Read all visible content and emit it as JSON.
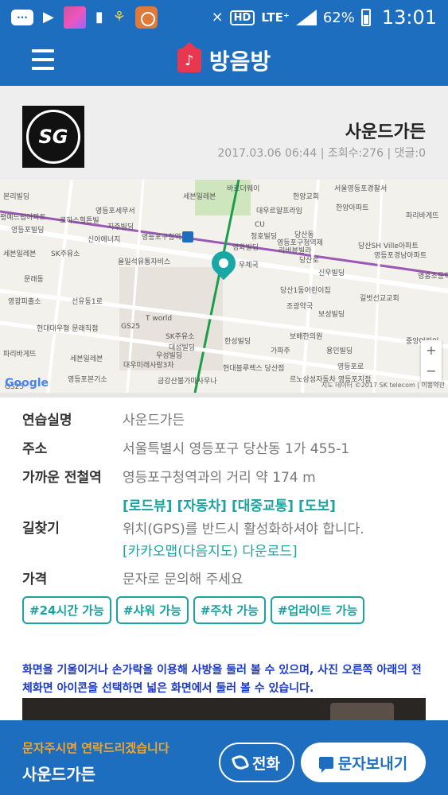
{
  "status_bar": {
    "network": "LTE⁺",
    "hd": "HD",
    "battery": "62%",
    "time": "13:01",
    "icons": [
      "chat-icon",
      "play-icon",
      "app-icon",
      "sim-icon",
      "ribbon-icon",
      "app-icon",
      "mute-vibrate-icon",
      "signal-icon",
      "battery-icon"
    ]
  },
  "app_bar": {
    "title": "방음방",
    "logo_icon": "music-note-icon",
    "menu_icon": "hamburger-icon"
  },
  "header": {
    "title": "사운드가든",
    "meta": "2017.03.06 06:44 | 조회수:276 | 댓글:0",
    "logo_text": "SG"
  },
  "map": {
    "labels": [
      "바르더웨이",
      "한양교회",
      "서울영등포경찰서",
      "영등포세무서",
      "대우르얄프라임",
      "한양아파트",
      "본리빌딩",
      "세븐일레븐",
      "파리바게뜨",
      "평예드림아파트",
      "로하스힐튼빌",
      "지주빌딩",
      "청호빌딩",
      "CU",
      "당산동",
      "영등포빌딩",
      "신아에너지",
      "영등포구청역",
      "영등포구청역제",
      "리버뷰빌라",
      "당산SH Ville아파트",
      "영등포경남아파트",
      "SK주유소",
      "율일석유통자비스",
      "영화빌딩",
      "당산로",
      "신우빌딩",
      "세븐일레븐",
      "문래동",
      "우체국",
      "당산1동어린이집",
      "영흥초등학교",
      "영광피출소",
      "선유동1로",
      "조광약국",
      "길벗선교교회",
      "T world",
      "보성빌딩",
      "현대대우형 문래직점",
      "GS25",
      "SK주유소",
      "대성빌딩",
      "보배한의원",
      "우성빌딩",
      "한성빌딩",
      "중앙어린이",
      "용인빌딩",
      "가파주",
      "파리바게뜨",
      "세븐일레븐",
      "대우미래사랑3차",
      "현대블루렉스 당산점",
      "영등포로",
      "영등포본기소",
      "금강산불가마사우나",
      "르노삼성자동차 영등포지점",
      "GS25",
      "지도 데이터 ©2017 SK telecom",
      "이용약관"
    ],
    "pin_icon": "location-pin-icon",
    "zoom_in": "+",
    "zoom_out": "−",
    "brand": "Google",
    "attribution": "지도 데이터 ©2017 SK telecom | 이용약관"
  },
  "info": {
    "studio_label": "연습실명",
    "studio_value": "사운드가든",
    "address_label": "주소",
    "address_value": "서울특별시 영등포구 당산동 1가 455-1",
    "station_label": "가까운 전철역",
    "station_value": "영등포구청역과의 거리 약 174 m",
    "directions_label": "길찾기",
    "directions_links": [
      "[로드뷰]",
      "[자동차]",
      "[대중교통]",
      "[도보]"
    ],
    "directions_notice": "위치(GPS)를 반드시 활성화하셔야 합니다.",
    "directions_kakao": "[카카오맵(다음지도) 다운로드]",
    "price_label": "가격",
    "price_value": "문자로 문의해 주세요",
    "tags": [
      "#24시간 가능",
      "#샤워 가능",
      "#주차 가능",
      "#업라이트 가능"
    ]
  },
  "notice": "화면을 기울이거나 손가락을 이용해 사방을 둘러 볼 수 있으며, 사진 오른쪽 아래의 전체화면 아이콘을 선택하면 넓은 화면에서 둘러 볼 수 있습니다.",
  "bottom_bar": {
    "subtitle": "문자주시면 연락드리겠습니다",
    "name": "사운드가든",
    "call_label": "전화",
    "sms_label": "문자보내기"
  },
  "colors": {
    "primary": "#1d6ebf",
    "accent": "#1aa3a0",
    "logo_red": "#e8384f",
    "notice_blue": "#1a39c8",
    "subtitle_orange": "#f5a623"
  }
}
